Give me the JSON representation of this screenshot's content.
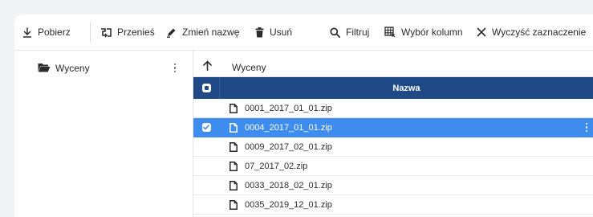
{
  "toolbar": {
    "download_label": "Pobierz",
    "move_label": "Przenieś",
    "rename_label": "Zmień nazwę",
    "delete_label": "Usuń",
    "filter_label": "Filtruj",
    "columns_label": "Wybór kolumn",
    "clear_selection_label": "Wyczyść zaznaczenie"
  },
  "sidebar": {
    "folders": [
      {
        "label": "Wyceny",
        "icon": "folder-open-icon"
      }
    ]
  },
  "path": {
    "current": "Wyceny"
  },
  "grid": {
    "columns": [
      "Nazwa"
    ],
    "rows": [
      {
        "name": "0001_2017_01_01.zip",
        "selected": false
      },
      {
        "name": "0004_2017_01_01.zip",
        "selected": true
      },
      {
        "name": "0009_2017_02_01.zip",
        "selected": false
      },
      {
        "name": "07_2017_02.zip",
        "selected": false
      },
      {
        "name": "0033_2018_02_01.zip",
        "selected": false
      },
      {
        "name": "0035_2019_12_01.zip",
        "selected": false
      }
    ]
  },
  "colors": {
    "header_bg": "#1f4a87",
    "selected_row_bg": "#3e8cee",
    "page_bg": "#f2f3f7"
  }
}
